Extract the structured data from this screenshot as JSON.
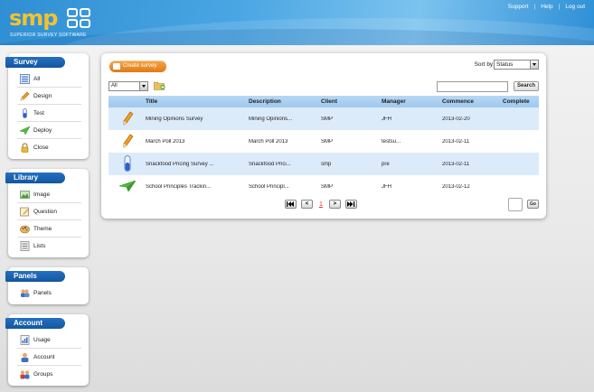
{
  "brand": {
    "logo_text": "smp",
    "tagline": "SUPERIOR SURVEY SOFTWARE",
    "accent": "#f2c230",
    "header_color": "#2f8fd3"
  },
  "toplinks": {
    "support": "Support",
    "help": "Help",
    "logout": "Log out",
    "separator": "|"
  },
  "sidebar": {
    "survey": {
      "title": "Survey",
      "items": [
        {
          "label": "All",
          "icon": "list-icon"
        },
        {
          "label": "Design",
          "icon": "pencil-icon"
        },
        {
          "label": "Test",
          "icon": "test-tube-icon"
        },
        {
          "label": "Deploy",
          "icon": "paper-plane-icon"
        },
        {
          "label": "Close",
          "icon": "padlock-icon"
        }
      ]
    },
    "library": {
      "title": "Library",
      "items": [
        {
          "label": "Image",
          "icon": "image-icon"
        },
        {
          "label": "Question",
          "icon": "question-icon"
        },
        {
          "label": "Theme",
          "icon": "theme-icon"
        },
        {
          "label": "Lists",
          "icon": "lists-icon"
        }
      ]
    },
    "panels": {
      "title": "Panels",
      "items": [
        {
          "label": "Panels",
          "icon": "people-icon"
        }
      ]
    },
    "account": {
      "title": "Account",
      "items": [
        {
          "label": "Usage",
          "icon": "usage-icon"
        },
        {
          "label": "Account",
          "icon": "user-icon"
        },
        {
          "label": "Groups",
          "icon": "groups-icon"
        }
      ]
    }
  },
  "main": {
    "create_label": "Create survey",
    "sort_label": "Sort by:",
    "sort_value": "Status",
    "filter_value": "All",
    "search_value": "",
    "search_label": "Search",
    "columns": [
      "",
      "Title",
      "Description",
      "Client",
      "Manager",
      "Commence",
      "Complete"
    ],
    "rows": [
      {
        "icon": "pencil-icon",
        "title": "Mining Opinions Survey",
        "description": "Mining Opinions...",
        "client": "SMP",
        "manager": "JFH",
        "commence": "2013-02-20",
        "complete": ""
      },
      {
        "icon": "pencil-icon",
        "title": "March Poll 2013",
        "description": "March Poll 2013",
        "client": "SMP",
        "manager": "testsu...",
        "commence": "2013-02-11",
        "complete": ""
      },
      {
        "icon": "test-tube-icon",
        "title": "Snackfood Pricing Survey ...",
        "description": "Snackfood Prici...",
        "client": "smp",
        "manager": "pre",
        "commence": "2013-02-11",
        "complete": ""
      },
      {
        "icon": "paper-plane-icon",
        "title": "School Principles Trackin...",
        "description": "School Principl...",
        "client": "SMP",
        "manager": "JFH",
        "commence": "2013-02-12",
        "complete": ""
      }
    ],
    "pager": {
      "first": "⏮",
      "prev": "<",
      "page": "1",
      "next": ">",
      "last": "⏭",
      "go": "Go"
    }
  }
}
